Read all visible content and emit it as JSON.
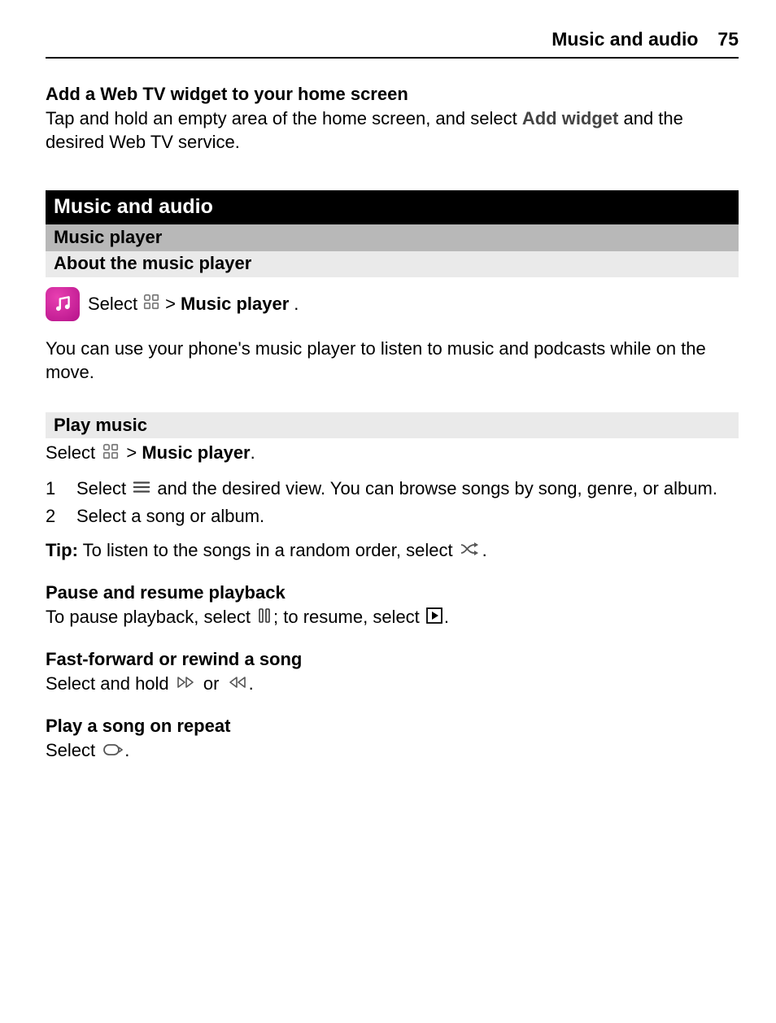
{
  "header": {
    "title": "Music and audio",
    "page": "75"
  },
  "section_add_widget": {
    "heading": "Add a Web TV widget to your home screen",
    "line1a": "Tap and hold an empty area of the home screen, and select ",
    "addwidget": "Add widget",
    "line1b": " and the desired Web TV service."
  },
  "bars": {
    "black": "Music and audio",
    "grey": "Music player",
    "light": "About the music player",
    "light2": "Play music"
  },
  "select_intro": {
    "select": " Select ",
    "gt": " > ",
    "mp": "Music player",
    "dot": "."
  },
  "about_para": "You can use your phone's music player to listen to music and podcasts while on the move.",
  "playmusic": {
    "select": "Select ",
    "gt": " > ",
    "mp": "Music player",
    "dot": "."
  },
  "steps": {
    "s1a": "Select ",
    "s1b": " and the desired view. You can browse songs by song, genre, or album.",
    "s2": "Select a song or album."
  },
  "tip": {
    "label": "Tip:",
    "a": " To listen to the songs in a random order, select ",
    "dot": "."
  },
  "pause": {
    "heading": "Pause and resume playback",
    "a": "To pause playback, select ",
    "b": "; to resume, select ",
    "dot": "."
  },
  "ff": {
    "heading": "Fast-forward or rewind a song",
    "a": "Select and hold ",
    "or": " or ",
    "dot": "."
  },
  "repeat": {
    "heading": "Play a song on repeat",
    "a": "Select ",
    "dot": "."
  }
}
